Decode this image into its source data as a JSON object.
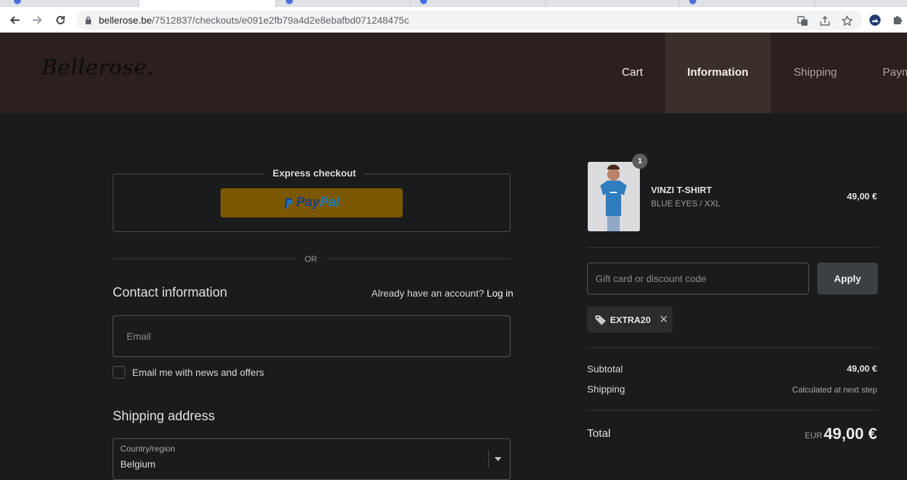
{
  "browser": {
    "url_host": "bellerose.be",
    "url_path": "/7512837/checkouts/e091e2fb79a4d2e8ebafbd071248475c"
  },
  "header": {
    "logo": "Bellerose.",
    "breadcrumbs": [
      {
        "label": "Cart"
      },
      {
        "label": "Information"
      },
      {
        "label": "Shipping"
      },
      {
        "label": "Paym"
      }
    ]
  },
  "checkout": {
    "express_title": "Express checkout",
    "paypal_label_1": "Pay",
    "paypal_label_2": "Pal",
    "or_text": "OR",
    "contact_title": "Contact information",
    "account_prompt": "Already have an account?",
    "login_label": "Log in",
    "email_placeholder": "Email",
    "newsletter_label": "Email me with news and offers",
    "shipping_title": "Shipping address",
    "country_label": "Country/region",
    "country_value": "Belgium"
  },
  "summary": {
    "item": {
      "quantity": "1",
      "name": "VINZI T-SHIRT",
      "variant": "BLUE EYES / XXL",
      "price": "49,00 €"
    },
    "discount_placeholder": "Gift card or discount code",
    "apply_label": "Apply",
    "applied_code": "EXTRA20",
    "subtotal_label": "Subtotal",
    "subtotal_value": "49,00 €",
    "shipping_label": "Shipping",
    "shipping_value": "Calculated at next step",
    "total_label": "Total",
    "total_currency": "EUR",
    "total_value": "49,00 €"
  },
  "colors": {
    "header_bg": "#2b201d",
    "page_bg": "#1a1b1c",
    "paypal_bg": "#7a5700"
  }
}
